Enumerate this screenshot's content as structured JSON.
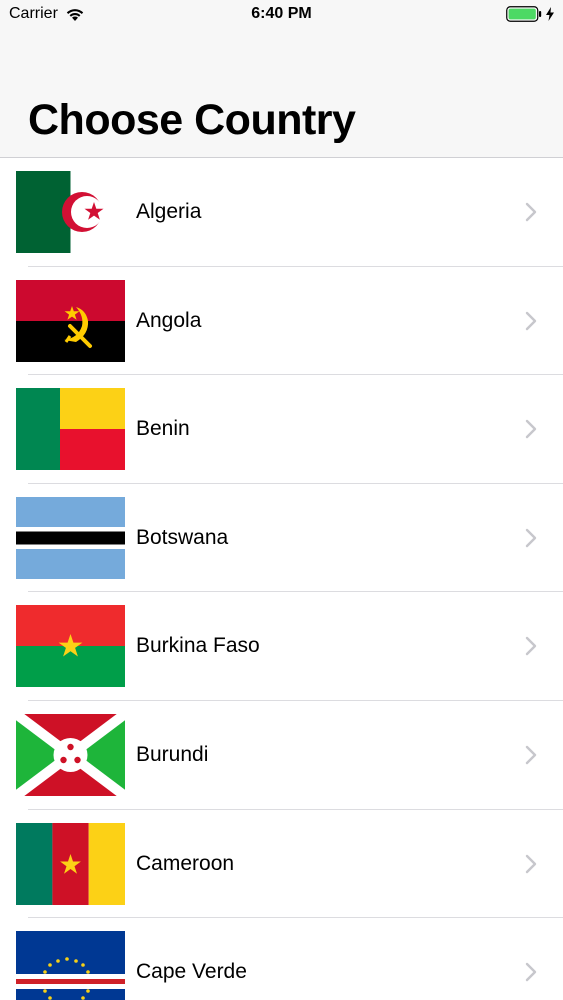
{
  "status_bar": {
    "carrier": "Carrier",
    "time": "6:40 PM",
    "battery_color": "#4cd964"
  },
  "header": {
    "title": "Choose Country"
  },
  "countries": [
    {
      "name": "Algeria",
      "flag_icon": "algeria-flag-icon"
    },
    {
      "name": "Angola",
      "flag_icon": "angola-flag-icon"
    },
    {
      "name": "Benin",
      "flag_icon": "benin-flag-icon"
    },
    {
      "name": "Botswana",
      "flag_icon": "botswana-flag-icon"
    },
    {
      "name": "Burkina Faso",
      "flag_icon": "burkina-faso-flag-icon"
    },
    {
      "name": "Burundi",
      "flag_icon": "burundi-flag-icon"
    },
    {
      "name": "Cameroon",
      "flag_icon": "cameroon-flag-icon"
    },
    {
      "name": "Cape Verde",
      "flag_icon": "cape-verde-flag-icon"
    }
  ],
  "colors": {
    "chevron": "#c7c7cc",
    "separator": "#dcdce0",
    "header_bg": "#f7f7f7"
  }
}
